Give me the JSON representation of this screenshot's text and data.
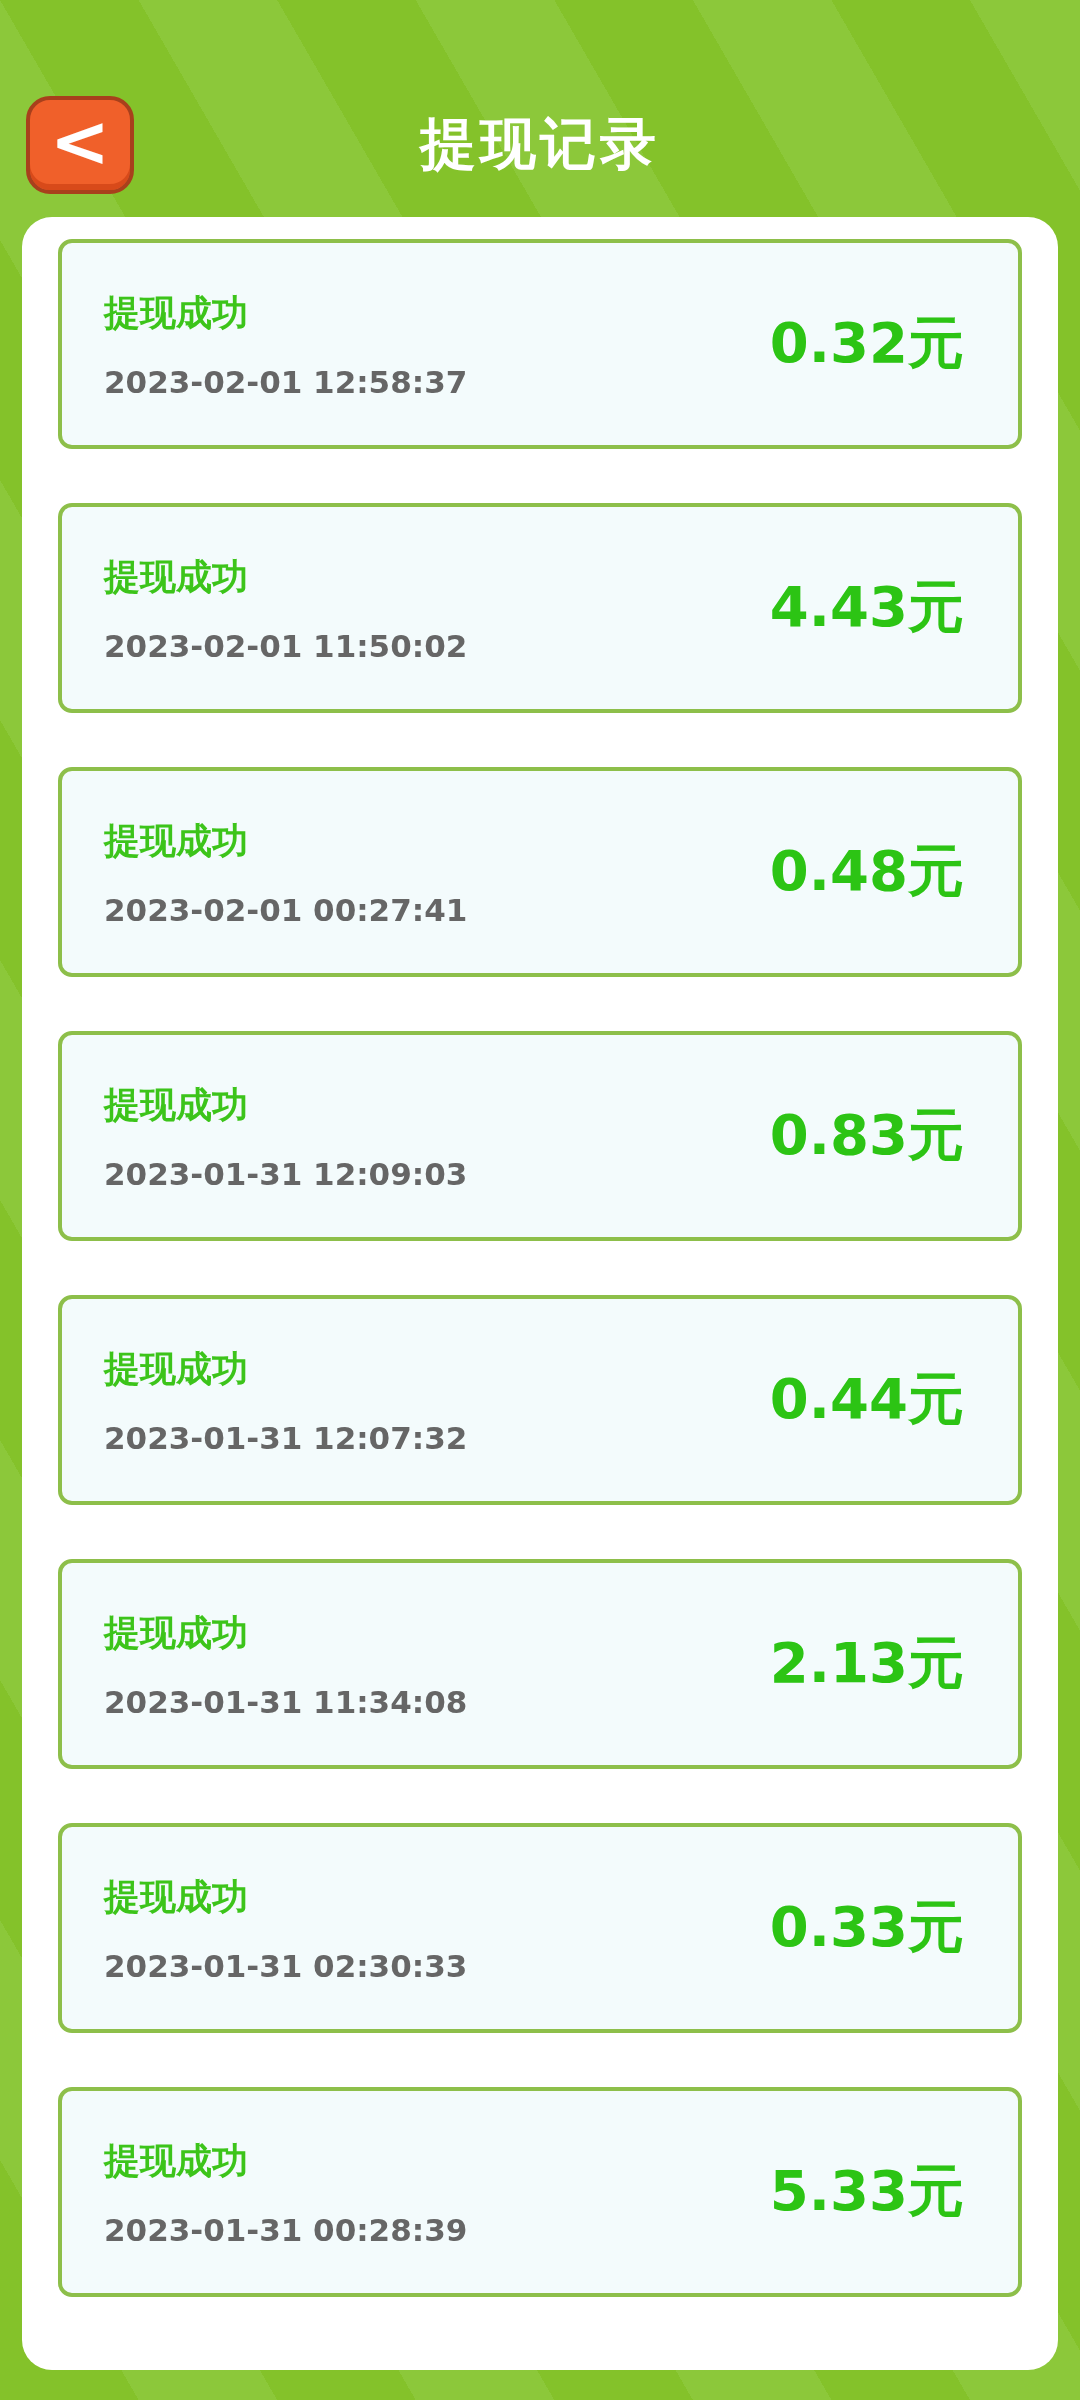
{
  "header": {
    "back_icon": "<",
    "title": "提现记录"
  },
  "records": [
    {
      "status": "提现成功",
      "time": "2023-02-01 12:58:37",
      "amount": "0.32元"
    },
    {
      "status": "提现成功",
      "time": "2023-02-01 11:50:02",
      "amount": "4.43元"
    },
    {
      "status": "提现成功",
      "time": "2023-02-01 00:27:41",
      "amount": "0.48元"
    },
    {
      "status": "提现成功",
      "time": "2023-01-31 12:09:03",
      "amount": "0.83元"
    },
    {
      "status": "提现成功",
      "time": "2023-01-31 12:07:32",
      "amount": "0.44元"
    },
    {
      "status": "提现成功",
      "time": "2023-01-31 11:34:08",
      "amount": "2.13元"
    },
    {
      "status": "提现成功",
      "time": "2023-01-31 02:30:33",
      "amount": "0.33元"
    },
    {
      "status": "提现成功",
      "time": "2023-01-31 00:28:39",
      "amount": "5.33元"
    }
  ]
}
